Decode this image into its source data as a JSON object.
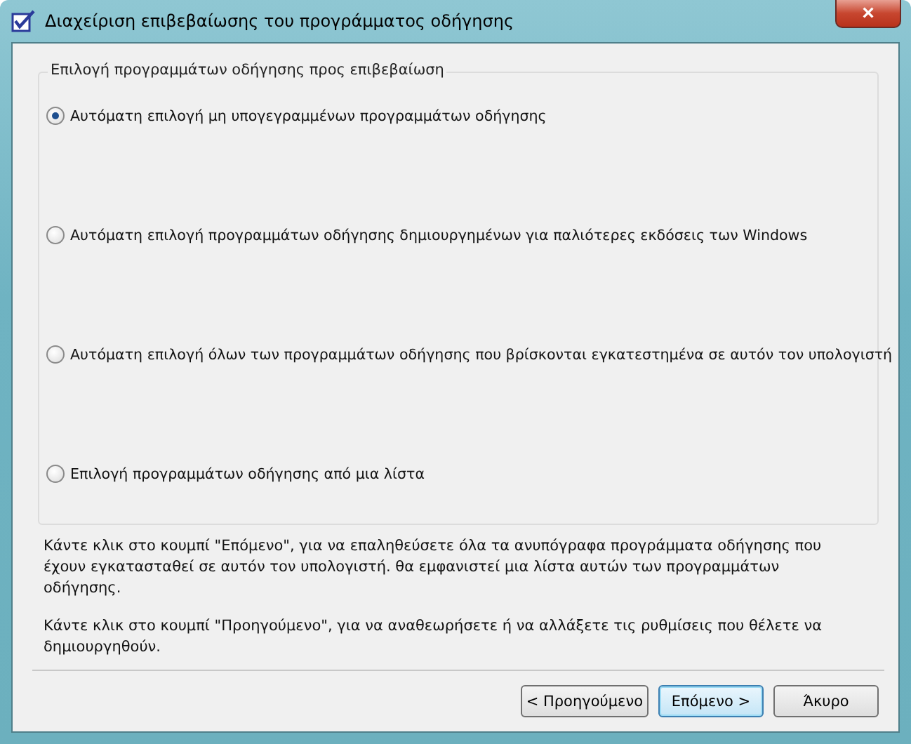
{
  "window": {
    "title": "Διαχείριση επιβεβαίωσης του προγράμματος οδήγησης",
    "close": "×"
  },
  "group": {
    "title": "Επιλογή προγραμμάτων οδήγησης προς επιβεβαίωση",
    "options": [
      {
        "label": "Αυτόματη επιλογή μη υπογεγραμμένων προγραμμάτων οδήγησης",
        "selected": true
      },
      {
        "label": "Αυτόματη επιλογή προγραμμάτων οδήγησης δημιουργημένων για παλιότερες εκδόσεις των Windows",
        "selected": false
      },
      {
        "label": "Αυτόματη επιλογή όλων των προγραμμάτων οδήγησης που βρίσκονται εγκατεστημένα σε αυτόν τον υπολογιστή",
        "selected": false
      },
      {
        "label": "Επιλογή προγραμμάτων οδήγησης από μια λίστα",
        "selected": false
      }
    ]
  },
  "paragraphs": [
    "Κάντε κλικ στο κουμπί \"Επόμενο\", για να επαληθεύσετε όλα τα ανυπόγραφα προγράμματα οδήγησης που έχουν εγκατασταθεί σε αυτόν τον υπολογιστή. θα εμφανιστεί μια λίστα αυτών των προγραμμάτων οδήγησης.",
    "Κάντε κλικ στο κουμπί \"Προηγούμενο\", για να αναθεωρήσετε ή να αλλάξετε τις ρυθμίσεις που θέλετε να δημιουργηθούν."
  ],
  "buttons": [
    {
      "label": "< Προηγούμενο",
      "kind": "normal"
    },
    {
      "label": "Επόμενο >",
      "kind": "default"
    },
    {
      "label": "Άκυρο",
      "kind": "normal"
    }
  ]
}
